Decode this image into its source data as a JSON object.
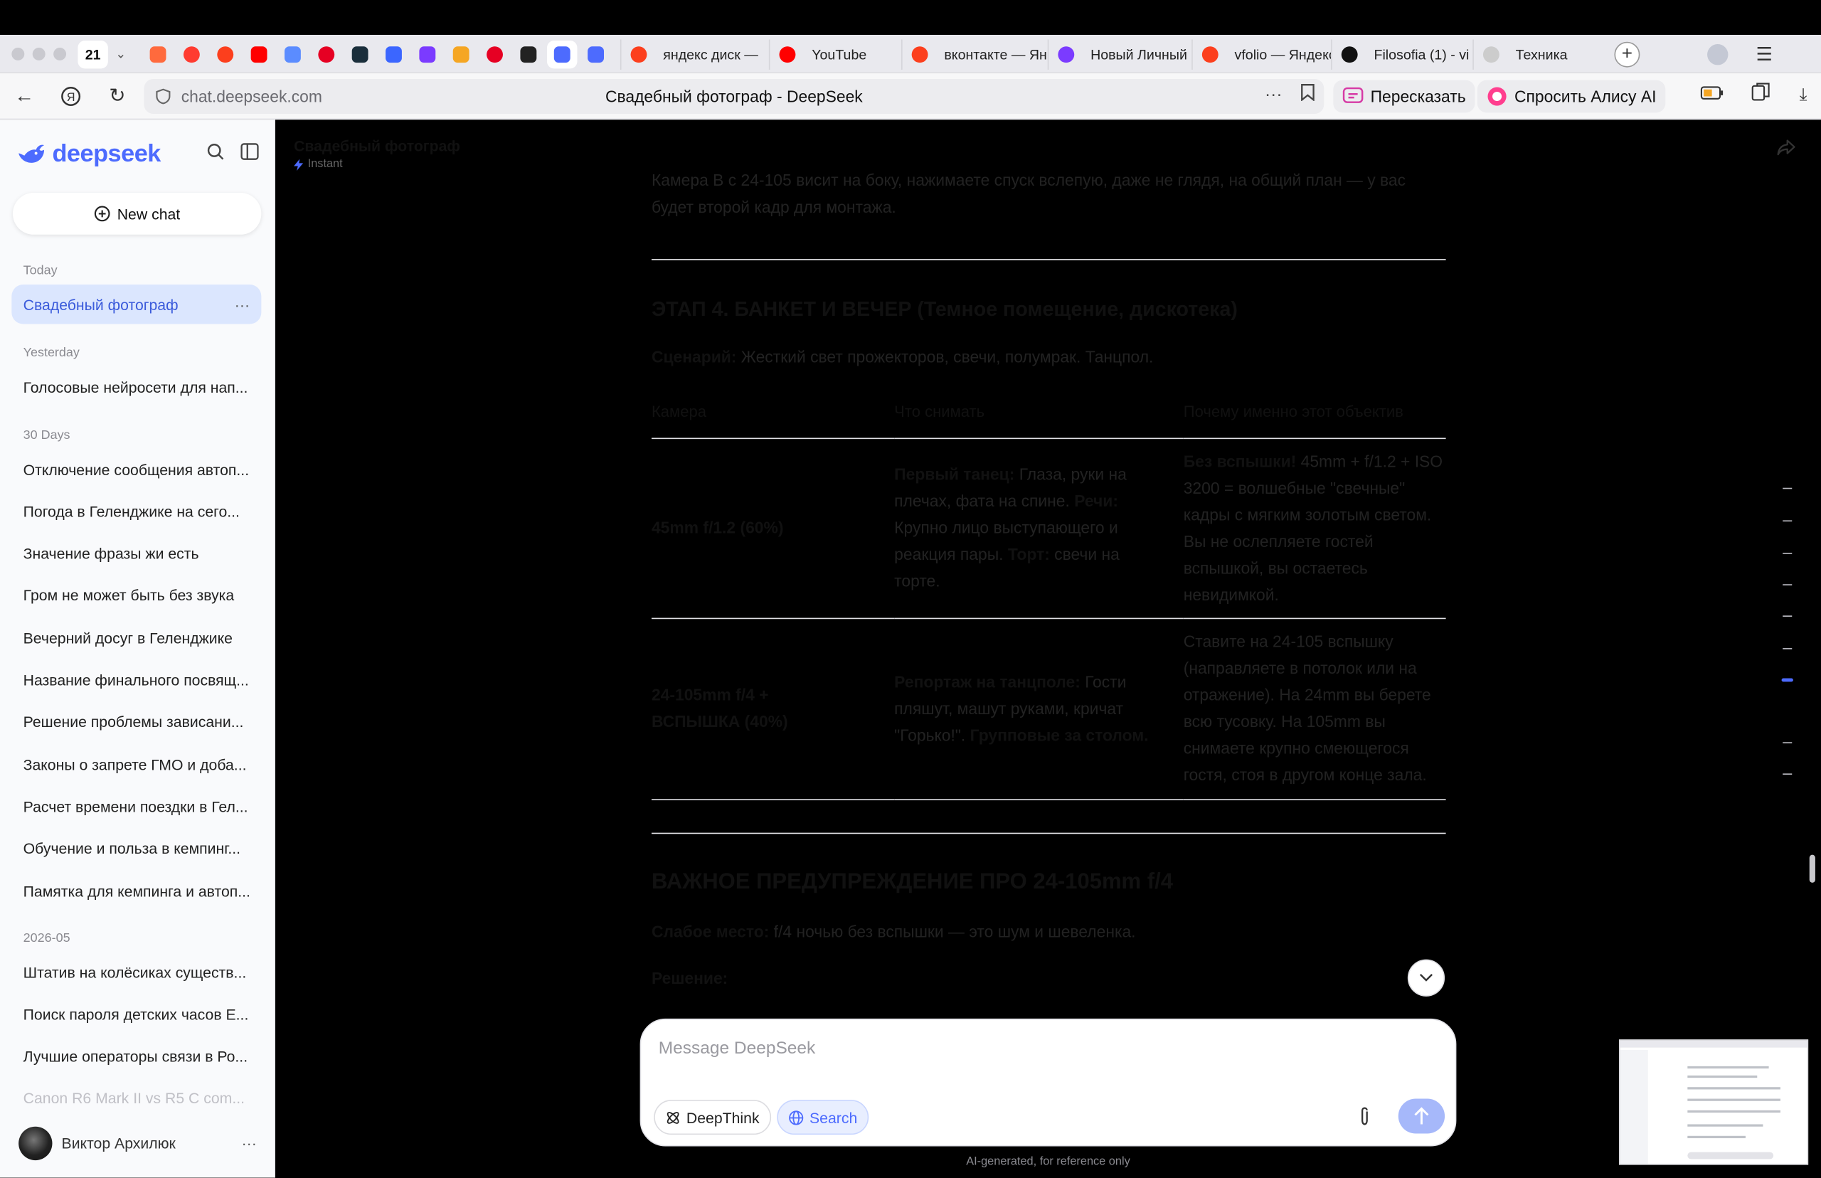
{
  "browser": {
    "tab_count": "21",
    "pinned_tabs": [
      {
        "icon": "cross-logo-icon",
        "color": "#ff6a3d"
      },
      {
        "icon": "maps-pin-icon",
        "color": "#ff3b30"
      },
      {
        "icon": "yandex-icon",
        "color": "#fc3f1d"
      },
      {
        "icon": "youtube-icon",
        "color": "#ff0000"
      },
      {
        "icon": "apps-icon",
        "color": "#5b8cff"
      },
      {
        "icon": "pinterest-icon",
        "color": "#e60023"
      },
      {
        "icon": "vimeo-icon",
        "color": "#1a2e3b"
      },
      {
        "icon": "wing-icon",
        "color": "#3b66ff"
      },
      {
        "icon": "chat-bubble-icon",
        "color": "#7b3bff"
      },
      {
        "icon": "coins-icon",
        "color": "#f5a623"
      },
      {
        "icon": "pinterest-icon",
        "color": "#e60023"
      },
      {
        "icon": "gear-icon",
        "color": "#222222"
      },
      {
        "icon": "deepseek-icon",
        "color": "#4d6bfe"
      },
      {
        "icon": "at-icon",
        "color": "#4d6bfe"
      }
    ],
    "tabs": [
      {
        "title": "яндекс диск —",
        "color": "#fc3f1d"
      },
      {
        "title": "YouTube",
        "color": "#ff0000"
      },
      {
        "title": "вконтакте — Ян",
        "color": "#fc3f1d"
      },
      {
        "title": "Новый Личный",
        "color": "#7b3bff"
      },
      {
        "title": "vfolio — Яндекс",
        "color": "#fc3f1d"
      },
      {
        "title": "Filosofia (1) - vi",
        "color": "#111111"
      },
      {
        "title": "Техника",
        "color": "#cccccc"
      }
    ],
    "url": "chat.deepseek.com",
    "page_title": "Свадебный фотограф - DeepSeek",
    "retell_label": "Пересказать",
    "alice_label": "Спросить Алису AI"
  },
  "sidebar": {
    "brand": "deepseek",
    "new_chat": "New chat",
    "today_label": "Today",
    "today": [
      {
        "title": "Свадебный фотограф"
      }
    ],
    "yesterday_label": "Yesterday",
    "yesterday": [
      {
        "title": "Голосовые нейросети для нап..."
      }
    ],
    "days30_label": "30 Days",
    "days30": [
      {
        "title": "Отключение сообщения автоп..."
      },
      {
        "title": "Погода в Геленджике на сего..."
      },
      {
        "title": "Значение фразы жи есть"
      },
      {
        "title": "Гром не может быть без звука"
      },
      {
        "title": "Вечерний досуг в Геленджике"
      },
      {
        "title": "Название финального посвящ..."
      },
      {
        "title": "Решение проблемы зависани..."
      },
      {
        "title": "Законы о запрете ГМО и доба..."
      },
      {
        "title": "Расчет времени поездки в Гел..."
      },
      {
        "title": "Обучение и польза в кемпинг..."
      },
      {
        "title": "Памятка для кемпинга и автоп..."
      }
    ],
    "month_label": "2026-05",
    "month": [
      {
        "title": "Штатив на колёсиках существ..."
      },
      {
        "title": "Поиск пароля детских часов Е..."
      },
      {
        "title": "Лучшие операторы связи в Ро..."
      },
      {
        "title": "Canon R6 Mark II vs R5 C com..."
      }
    ],
    "user_name": "Виктор Архилюк"
  },
  "chat": {
    "title": "Свадебный фотограф",
    "mode": "Instant",
    "intro_text": "Камера В с 24-105 висит на боку, нажимаете спуск вслепую, даже не глядя, на общий план — у вас будет второй кадр для монтажа.",
    "stage4_heading": "ЭТАП 4. БАНКЕТ И ВЕЧЕР (Темное помещение, дискотека)",
    "scenario_label": "Сценарий:",
    "scenario_text": " Жесткий свет прожекторов, свечи, полумрак. Танцпол.",
    "table": {
      "headers": [
        "Камера",
        "Что снимать",
        "Почему именно этот объектив"
      ],
      "rows": [
        {
          "camera": "45mm f/1.2 (60%)",
          "what": [
            {
              "b": "Первый танец:"
            },
            {
              "t": " Глаза, руки на плечах, фата на спине. "
            },
            {
              "b": "Речи:"
            },
            {
              "t": " Крупно лицо выступающего и реакция пары. "
            },
            {
              "b": "Торт:"
            },
            {
              "t": " свечи на торте."
            }
          ],
          "why": [
            {
              "b": "Без вспышки!"
            },
            {
              "t": " 45mm + f/1.2 + ISO 3200 = волшебные \"свечные\" кадры с мягким золотым светом. Вы не ослепляете гостей вспышкой, вы остаетесь невидимкой."
            }
          ]
        },
        {
          "camera": "24-105mm f/4 + ВСПЫШКА (40%)",
          "what": [
            {
              "b": "Репортаж на танцполе:"
            },
            {
              "t": " Гости пляшут, машут руками, кричат \"Горько!\". "
            },
            {
              "b": "Групповые за столом."
            }
          ],
          "why": [
            {
              "t": "Ставите на 24-105 вспышку (направляете в потолок или на отражение). На 24mm вы берете всю тусовку. На 105mm вы снимаете крупно смеющегося гостя, стоя в другом конце зала."
            }
          ]
        }
      ]
    },
    "warning_heading": "ВАЖНОЕ ПРЕДУПРЕЖДЕНИЕ ПРО 24-105mm f/4",
    "weak_label": "Слабое место:",
    "weak_text": " f/4 ночью без вспышки — это шум и шевеленка.",
    "solution_label": "Решение:"
  },
  "composer": {
    "placeholder": "Message DeepSeek",
    "deepthink": "DeepThink",
    "search": "Search",
    "disclaimer": "AI-generated, for reference only"
  },
  "colors": {
    "accent": "#4d6bfe",
    "active_chat_bg": "#dbe6fe",
    "search_bg": "#e8eeff",
    "send_disabled": "#a6b8fa"
  }
}
